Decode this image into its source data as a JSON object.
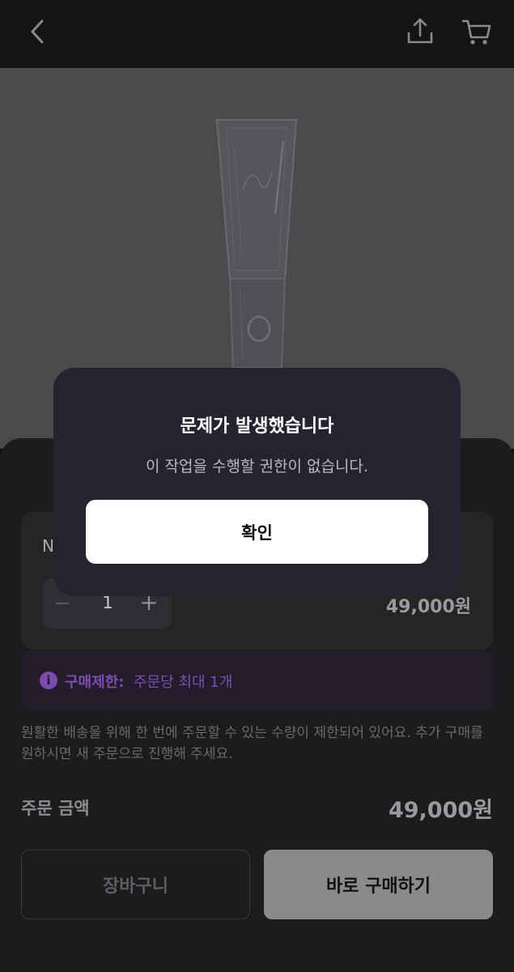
{
  "header": {
    "back_icon": "chevron-left-icon",
    "share_icon": "share-upload-icon",
    "cart_icon": "shopping-cart-icon"
  },
  "product": {
    "option": {
      "name_visible": "N",
      "quantity": "1",
      "minus_symbol": "−",
      "plus_symbol": "+",
      "price": "49,000원"
    },
    "limit": {
      "icon": "info-icon",
      "icon_glyph": "i",
      "label": "구매제한:",
      "value": "주문당 최대 1개"
    },
    "notice": "원활한 배송을 위해 한 번에 주문할 수 있는 수량이 제한되어 있어요. 추가 구매를 원하시면 새 주문으로 진행해 주세요.",
    "total": {
      "label": "주문 금액",
      "value": "49,000원"
    },
    "actions": {
      "cart_label": "장바구니",
      "buy_label": "바로 구매하기"
    }
  },
  "dialog": {
    "title": "문제가 발생했습니다",
    "message": "이 작업을 수행할 권한이 없습니다.",
    "confirm_label": "확인"
  },
  "colors": {
    "background": "#0f0f11",
    "dialog_bg": "#242430",
    "accent_purple": "#7d4fb3",
    "confirm_bg": "#ffffff"
  }
}
